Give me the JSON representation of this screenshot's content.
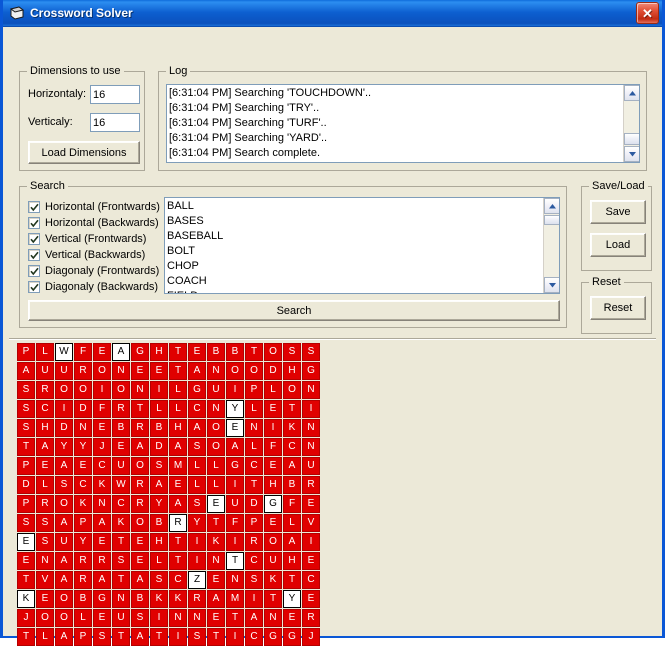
{
  "window": {
    "title": "Crossword Solver",
    "icon": "app-window-icon",
    "close_label": "✕",
    "title_bar_color": "#0b51bd",
    "accent_color": "#0a57d6"
  },
  "dimensions_group": {
    "title": "Dimensions to use",
    "horizontal_label": "Horizontaly:",
    "horizontal_value": "16",
    "vertical_label": "Verticaly:",
    "vertical_value": "16",
    "load_button": "Load Dimensions"
  },
  "log_group": {
    "title": "Log",
    "entries": [
      "[6:31:04 PM] Searching 'TOUCHDOWN'..",
      "[6:31:04 PM] Searching 'TRY'..",
      "[6:31:04 PM] Searching 'TURF'..",
      "[6:31:04 PM] Searching 'YARD'..",
      "[6:31:04 PM] Search complete."
    ]
  },
  "search_group": {
    "title": "Search",
    "options": [
      {
        "label": "Horizontal (Frontwards)",
        "checked": true
      },
      {
        "label": "Horizontal (Backwards)",
        "checked": true
      },
      {
        "label": "Vertical (Frontwards)",
        "checked": true
      },
      {
        "label": "Vertical (Backwards)",
        "checked": true
      },
      {
        "label": "Diagonaly (Frontwards)",
        "checked": true
      },
      {
        "label": "Diagonaly (Backwards)",
        "checked": true
      }
    ],
    "search_button": "Search",
    "words": [
      "BALL",
      "BASES",
      "BASEBALL",
      "BOLT",
      "CHOP",
      "COACH",
      "FIELD"
    ]
  },
  "saveload_group": {
    "title": "Save/Load",
    "save_button": "Save",
    "load_button": "Load"
  },
  "reset_group": {
    "title": "Reset",
    "reset_button": "Reset"
  },
  "grid": {
    "columns": 16,
    "rows": 16,
    "cell_color": "#e00000",
    "cell_border_color": "#b50000",
    "letter_color": "#ffffff",
    "highlight_color": "#ffffff",
    "highlight_letter_color": "#000000",
    "letters": [
      [
        "P",
        "L",
        "W",
        "F",
        "E",
        "A",
        "G",
        "H",
        "T",
        "E",
        "B",
        "B",
        "T",
        "O",
        "S",
        "S"
      ],
      [
        "A",
        "U",
        "U",
        "R",
        "O",
        "N",
        "E",
        "E",
        "T",
        "A",
        "N",
        "O",
        "O",
        "D",
        "H",
        "G"
      ],
      [
        "S",
        "R",
        "O",
        "O",
        "I",
        "O",
        "N",
        "I",
        "L",
        "G",
        "U",
        "I",
        "P",
        "L",
        "O",
        "N"
      ],
      [
        "S",
        "C",
        "I",
        "D",
        "F",
        "R",
        "T",
        "L",
        "L",
        "C",
        "N",
        "Y",
        "L",
        "E",
        "T",
        "I"
      ],
      [
        "S",
        "H",
        "D",
        "N",
        "E",
        "B",
        "R",
        "B",
        "H",
        "A",
        "O",
        "E",
        "N",
        "I",
        "K",
        "N"
      ],
      [
        "T",
        "A",
        "Y",
        "Y",
        "J",
        "E",
        "A",
        "D",
        "A",
        "S",
        "O",
        "A",
        "L",
        "F",
        "C",
        "N"
      ],
      [
        "P",
        "E",
        "A",
        "E",
        "C",
        "U",
        "O",
        "S",
        "M",
        "L",
        "L",
        "G",
        "C",
        "E",
        "A",
        "U"
      ],
      [
        "D",
        "L",
        "S",
        "C",
        "K",
        "W",
        "R",
        "A",
        "E",
        "L",
        "L",
        "I",
        "T",
        "H",
        "B",
        "R"
      ],
      [
        "P",
        "R",
        "O",
        "K",
        "N",
        "C",
        "R",
        "Y",
        "A",
        "S",
        "E",
        "U",
        "D",
        "G",
        "F",
        "E"
      ],
      [
        "S",
        "S",
        "A",
        "P",
        "A",
        "K",
        "O",
        "B",
        "R",
        "Y",
        "T",
        "F",
        "P",
        "E",
        "L",
        "V"
      ],
      [
        "E",
        "S",
        "U",
        "Y",
        "E",
        "T",
        "E",
        "H",
        "T",
        "I",
        "K",
        "I",
        "R",
        "O",
        "A",
        "I"
      ],
      [
        "E",
        "N",
        "A",
        "R",
        "R",
        "S",
        "E",
        "L",
        "T",
        "I",
        "N",
        "T",
        "C",
        "U",
        "H",
        "E"
      ],
      [
        "T",
        "V",
        "A",
        "R",
        "A",
        "T",
        "A",
        "S",
        "C",
        "Z",
        "E",
        "N",
        "S",
        "K",
        "T",
        "C"
      ],
      [
        "K",
        "E",
        "O",
        "B",
        "G",
        "N",
        "B",
        "K",
        "K",
        "R",
        "A",
        "M",
        "I",
        "T",
        "Y",
        "E"
      ],
      [
        "J",
        "O",
        "O",
        "L",
        "E",
        "U",
        "S",
        "I",
        "N",
        "N",
        "E",
        "T",
        "A",
        "N",
        "E",
        "R"
      ],
      [
        "T",
        "L",
        "A",
        "P",
        "S",
        "T",
        "A",
        "T",
        "I",
        "S",
        "T",
        "I",
        "C",
        "G",
        "G",
        "J"
      ]
    ],
    "highlights": [
      [
        0,
        2
      ],
      [
        0,
        5
      ],
      [
        3,
        11
      ],
      [
        4,
        11
      ],
      [
        8,
        10
      ],
      [
        8,
        13
      ],
      [
        9,
        8
      ],
      [
        10,
        0
      ],
      [
        11,
        11
      ],
      [
        12,
        9
      ],
      [
        13,
        0
      ],
      [
        13,
        14
      ]
    ]
  }
}
